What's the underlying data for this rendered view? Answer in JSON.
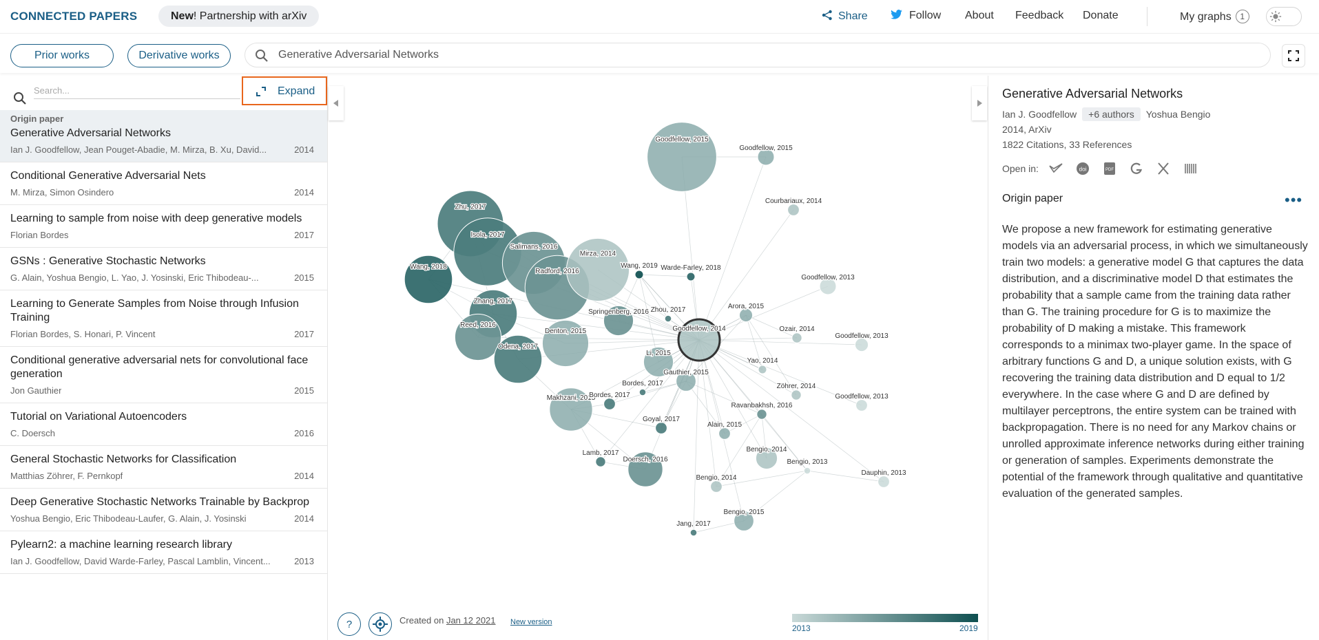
{
  "header": {
    "logo": "CONNECTED PAPERS",
    "news_bold": "New",
    "news_rest": "! Partnership with arXiv",
    "nav": {
      "share": "Share",
      "follow": "Follow",
      "about": "About",
      "feedback": "Feedback",
      "donate": "Donate",
      "my_graphs": "My graphs",
      "my_graphs_count": "1"
    }
  },
  "toolbar": {
    "prior_works": "Prior works",
    "derivative_works": "Derivative works",
    "search_value": "Generative Adversarial Networks"
  },
  "sidebar": {
    "search_placeholder": "Search...",
    "expand_label": "Expand",
    "papers": [
      {
        "tag": "Origin paper",
        "title": "Generative Adversarial Networks",
        "authors": "Ian J. Goodfellow, Jean Pouget-Abadie, M. Mirza, B. Xu, David...",
        "year": "2014"
      },
      {
        "title": "Conditional Generative Adversarial Nets",
        "authors": "M. Mirza, Simon Osindero",
        "year": "2014"
      },
      {
        "title": "Learning to sample from noise with deep generative models",
        "authors": "Florian Bordes",
        "year": "2017"
      },
      {
        "title": "GSNs : Generative Stochastic Networks",
        "authors": "G. Alain, Yoshua Bengio, L. Yao, J. Yosinski, Eric Thibodeau-...",
        "year": "2015"
      },
      {
        "title": "Learning to Generate Samples from Noise through Infusion Training",
        "authors": "Florian Bordes, S. Honari, P. Vincent",
        "year": "2017"
      },
      {
        "title": "Conditional generative adversarial nets for convolutional face generation",
        "authors": "Jon Gauthier",
        "year": "2015"
      },
      {
        "title": "Tutorial on Variational Autoencoders",
        "authors": "C. Doersch",
        "year": "2016"
      },
      {
        "title": "General Stochastic Networks for Classification",
        "authors": "Matthias Zöhrer, F. Pernkopf",
        "year": "2014"
      },
      {
        "title": "Deep Generative Stochastic Networks Trainable by Backprop",
        "authors": "Yoshua Bengio, Eric Thibodeau-Laufer, G. Alain, J. Yosinski",
        "year": "2014"
      },
      {
        "title": "Pylearn2: a machine learning research library",
        "authors": "Ian J. Goodfellow, David Warde-Farley, Pascal Lamblin, Vincent...",
        "year": "2013"
      }
    ]
  },
  "graph": {
    "nodes": [
      {
        "label": "Goodfellow, 2015",
        "year": 2015,
        "size": 4.2
      },
      {
        "label": "Goodfellow, 2015",
        "year": 2015,
        "size": 1.0
      },
      {
        "label": "Courbariaux, 2014",
        "year": 2014,
        "size": 0.7
      },
      {
        "label": "Zhu, 2017",
        "year": 2017,
        "size": 4.0
      },
      {
        "label": "Isola, 2017",
        "year": 2017,
        "size": 4.1
      },
      {
        "label": "Salimans, 2016",
        "year": 2016,
        "size": 3.8
      },
      {
        "label": "Wang, 2018",
        "year": 2018,
        "size": 2.9
      },
      {
        "label": "Radford, 2016",
        "year": 2016,
        "size": 3.9
      },
      {
        "label": "Mirza, 2014",
        "year": 2014,
        "size": 3.8
      },
      {
        "label": "Wang, 2019",
        "year": 2019,
        "size": 0.5
      },
      {
        "label": "Warde-Farley, 2018",
        "year": 2018,
        "size": 0.5
      },
      {
        "label": "Goodfellow, 2013",
        "year": 2013,
        "size": 1.0
      },
      {
        "label": "Zhang, 2017",
        "year": 2017,
        "size": 2.9
      },
      {
        "label": "Springenberg, 2016",
        "year": 2016,
        "size": 1.8
      },
      {
        "label": "Zhou, 2017",
        "year": 2017,
        "size": 0.4
      },
      {
        "label": "Arora, 2015",
        "year": 2015,
        "size": 0.8
      },
      {
        "label": "Reed, 2016",
        "year": 2016,
        "size": 2.8
      },
      {
        "label": "Denton, 2015",
        "year": 2015,
        "size": 2.8
      },
      {
        "label": "Goodfellow, 2014",
        "year": 2014,
        "size": 2.5
      },
      {
        "label": "Ozair, 2014",
        "year": 2014,
        "size": 0.6
      },
      {
        "label": "Goodfellow, 2013",
        "year": 2013,
        "size": 0.8
      },
      {
        "label": "Odena, 2017",
        "year": 2017,
        "size": 2.9
      },
      {
        "label": "Li, 2015",
        "year": 2015,
        "size": 1.8
      },
      {
        "label": "Yao, 2014",
        "year": 2014,
        "size": 0.5
      },
      {
        "label": "Gauthier, 2015",
        "year": 2015,
        "size": 1.2
      },
      {
        "label": "Bordes, 2017",
        "year": 2017,
        "size": 0.4
      },
      {
        "label": "Zöhrer, 2014",
        "year": 2014,
        "size": 0.6
      },
      {
        "label": "Makhzani, 2015",
        "year": 2015,
        "size": 2.6
      },
      {
        "label": "Goodfellow, 2013",
        "year": 2013,
        "size": 0.7
      },
      {
        "label": "Bordes, 2017",
        "year": 2017,
        "size": 0.7
      },
      {
        "label": "Ravanbakhsh, 2016",
        "year": 2016,
        "size": 0.6
      },
      {
        "label": "Goyal, 2017",
        "year": 2017,
        "size": 0.7
      },
      {
        "label": "Alain, 2015",
        "year": 2015,
        "size": 0.7
      },
      {
        "label": "Lamb, 2017",
        "year": 2017,
        "size": 0.6
      },
      {
        "label": "Bengio, 2014",
        "year": 2014,
        "size": 1.3
      },
      {
        "label": "Doersch, 2016",
        "year": 2016,
        "size": 2.1
      },
      {
        "label": "Bengio, 2013",
        "year": 2013,
        "size": 0.4
      },
      {
        "label": "Bengio, 2014",
        "year": 2014,
        "size": 0.7
      },
      {
        "label": "Dauphin, 2013",
        "year": 2013,
        "size": 0.7
      },
      {
        "label": "Bengio, 2015",
        "year": 2015,
        "size": 1.2
      },
      {
        "label": "Jang, 2017",
        "year": 2017,
        "size": 0.4
      }
    ],
    "created_prefix": "Created on",
    "created_date": "Jan 12 2021",
    "new_version": "New version",
    "legend_min": "2013",
    "legend_max": "2019",
    "help_label": "?"
  },
  "details": {
    "title": "Generative Adversarial Networks",
    "first_author": "Ian J. Goodfellow",
    "more_authors": "+6 authors",
    "last_author": "Yoshua Bengio",
    "venue": "2014, ArXiv",
    "citations": "1822 Citations, 33 References",
    "open_in": "Open in:",
    "section": "Origin paper",
    "more": "•••",
    "abstract": "We propose a new framework for estimating generative models via an adversarial process, in which we simultaneously train two models: a generative model G that captures the data distribution, and a discriminative model D that estimates the probability that a sample came from the training data rather than G. The training procedure for G is to maximize the probability of D making a mistake. This framework corresponds to a minimax two-player game. In the space of arbitrary functions G and D, a unique solution exists, with G recovering the training data distribution and D equal to 1/2 everywhere. In the case where G and D are defined by multilayer perceptrons, the entire system can be trained with backpropagation. There is no need for any Markov chains or unrolled approximate inference networks during either training or generation of samples. Experiments demonstrate the potential of the framework through qualitative and quantitative evaluation of the generated samples."
  },
  "colors": {
    "brand": "#1a5e86",
    "accent_border": "#e8661c",
    "node_old": "#c9d9d8",
    "node_new": "#0e4f50"
  }
}
